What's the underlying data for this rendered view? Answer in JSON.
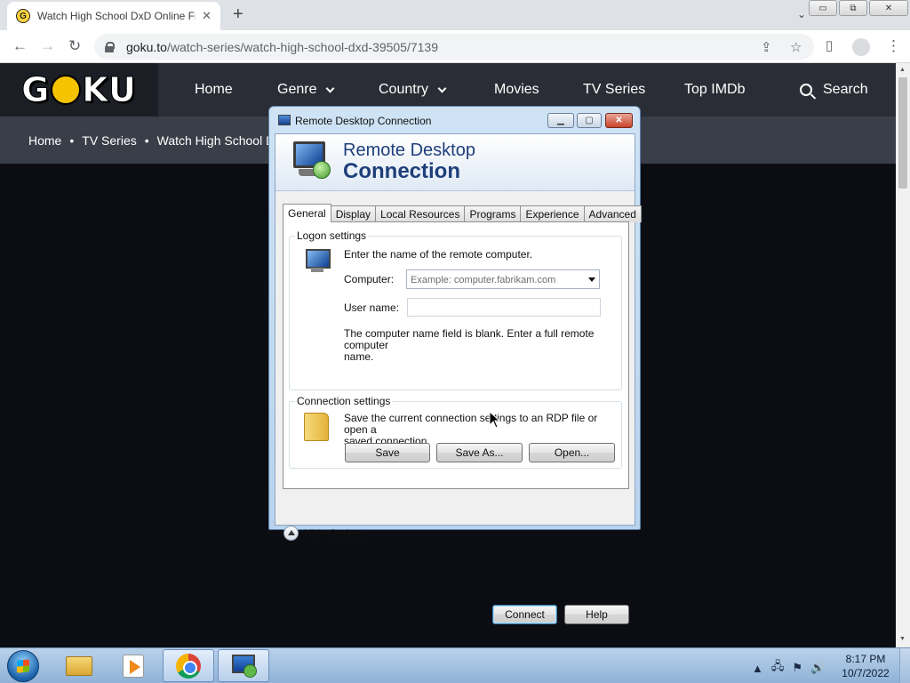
{
  "browser": {
    "tab_title": "Watch High School DxD Online Free",
    "tab_close": "✕",
    "new_tab": "+",
    "url_host": "goku.to",
    "url_path": "/watch-series/watch-high-school-dxd-39505/7139",
    "window_min": "▭",
    "window_restore": "⧉",
    "window_close": "✕"
  },
  "site": {
    "logo": {
      "left": "G",
      "right": "KU"
    },
    "nav": {
      "home": "Home",
      "genre": "Genre",
      "country": "Country",
      "movies": "Movies",
      "tv_series": "TV Series",
      "top_imdb": "Top IMDb",
      "search": "Search"
    },
    "breadcrumb": {
      "home": "Home",
      "tv_series": "TV Series",
      "current": "Watch High School D"
    }
  },
  "dialog": {
    "title": "Remote Desktop Connection",
    "banner_line1": "Remote Desktop",
    "banner_line2": "Connection",
    "tabs": [
      "General",
      "Display",
      "Local Resources",
      "Programs",
      "Experience",
      "Advanced"
    ],
    "logon": {
      "group_label": "Logon settings",
      "instruction": "Enter the name of the remote computer.",
      "computer_label": "Computer:",
      "computer_placeholder": "Example: computer.fabrikam.com",
      "username_label": "User name:",
      "username_value": "",
      "hint_line1": "The computer name field is blank. Enter a full remote computer",
      "hint_line2": "name."
    },
    "connection": {
      "group_label": "Connection settings",
      "text_line1": "Save the current connection settings to an RDP file or open a",
      "text_line2": "saved connection.",
      "save": "Save",
      "save_as": "Save As...",
      "open": "Open..."
    },
    "hide_options": "Hide Options",
    "connect": "Connect",
    "help": "Help"
  },
  "taskbar": {
    "time": "8:17 PM",
    "date": "10/7/2022"
  }
}
